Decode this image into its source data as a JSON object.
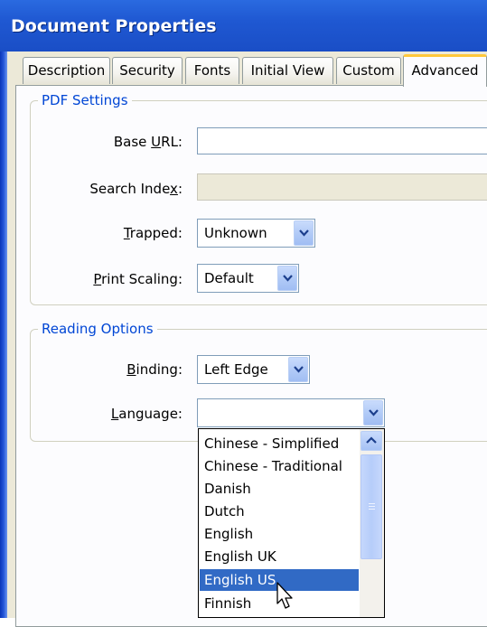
{
  "window": {
    "title": "Document Properties"
  },
  "tabs": [
    {
      "label": "Description"
    },
    {
      "label": "Security"
    },
    {
      "label": "Fonts"
    },
    {
      "label": "Initial View"
    },
    {
      "label": "Custom"
    },
    {
      "label": "Advanced",
      "active": true
    }
  ],
  "pdf_settings": {
    "legend": "PDF Settings",
    "base_url": {
      "label": "Base URL:",
      "value": ""
    },
    "search_index": {
      "label": "Search Index:",
      "value": ""
    },
    "trapped": {
      "label": "Trapped:",
      "value": "Unknown"
    },
    "print_scaling": {
      "label": "Print Scaling:",
      "value": "Default"
    }
  },
  "reading_options": {
    "legend": "Reading Options",
    "binding": {
      "label": "Binding:",
      "value": "Left Edge"
    },
    "language": {
      "label": "Language:",
      "value": ""
    }
  },
  "language_dropdown": {
    "options": [
      "Chinese - Simplified",
      "Chinese - Traditional",
      "Danish",
      "Dutch",
      "English",
      "English UK",
      "English US",
      "Finnish"
    ],
    "selected": "English US"
  },
  "colors": {
    "title_bar": "#1f58d2",
    "dialog_bg": "#ece9d8",
    "active_tab_accent": "#ffc83c",
    "group_legend": "#0046d5",
    "selection": "#316ac5"
  },
  "icons": {
    "combo_arrow": "chevron-down-icon",
    "scroll_up": "scroll-up-arrow-icon",
    "pointer": "mouse-pointer-icon"
  }
}
